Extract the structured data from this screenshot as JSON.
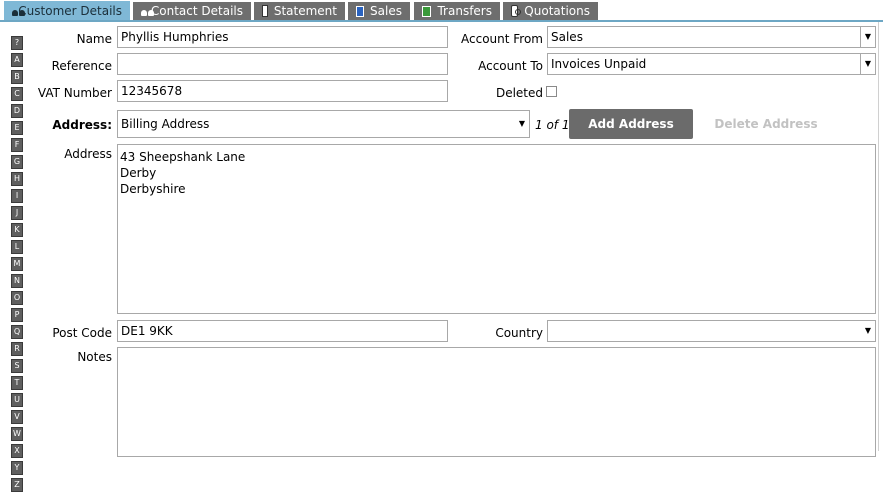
{
  "tabs": [
    {
      "label": "Customer Details",
      "icon": "people-icon"
    },
    {
      "label": "Contact Details",
      "icon": "people-icon"
    },
    {
      "label": "Statement",
      "icon": "document-icon"
    },
    {
      "label": "Sales",
      "icon": "sales-icon"
    },
    {
      "label": "Transfers",
      "icon": "transfers-icon"
    },
    {
      "label": "Quotations",
      "icon": "quotations-icon"
    }
  ],
  "alpha_index": [
    "?",
    "A",
    "B",
    "C",
    "D",
    "E",
    "F",
    "G",
    "H",
    "I",
    "J",
    "K",
    "L",
    "M",
    "N",
    "O",
    "P",
    "Q",
    "R",
    "S",
    "T",
    "U",
    "V",
    "W",
    "X",
    "Y",
    "Z"
  ],
  "form": {
    "name_label": "Name",
    "name_value": "Phyllis Humphries",
    "reference_label": "Reference",
    "reference_value": "",
    "vat_label": "VAT Number",
    "vat_value": "12345678",
    "account_from_label": "Account From",
    "account_from_value": "Sales",
    "account_to_label": "Account To",
    "account_to_value": "Invoices Unpaid",
    "deleted_label": "Deleted",
    "deleted_checked": false,
    "address_select_label": "Address:",
    "address_select_value": "Billing Address",
    "address_counter": "1 of 1",
    "add_address_label": "Add Address",
    "delete_address_label": "Delete Address",
    "address_label": "Address",
    "address_value": "43 Sheepshank Lane\nDerby\nDerbyshire",
    "postcode_label": "Post Code",
    "postcode_value": "DE1 9KK",
    "country_label": "Country",
    "country_value": "",
    "notes_label": "Notes",
    "notes_value": ""
  },
  "colors": {
    "active_tab": "#7fb8d6",
    "inactive_tab": "#6e6e6e",
    "button": "#6b6b6b"
  }
}
